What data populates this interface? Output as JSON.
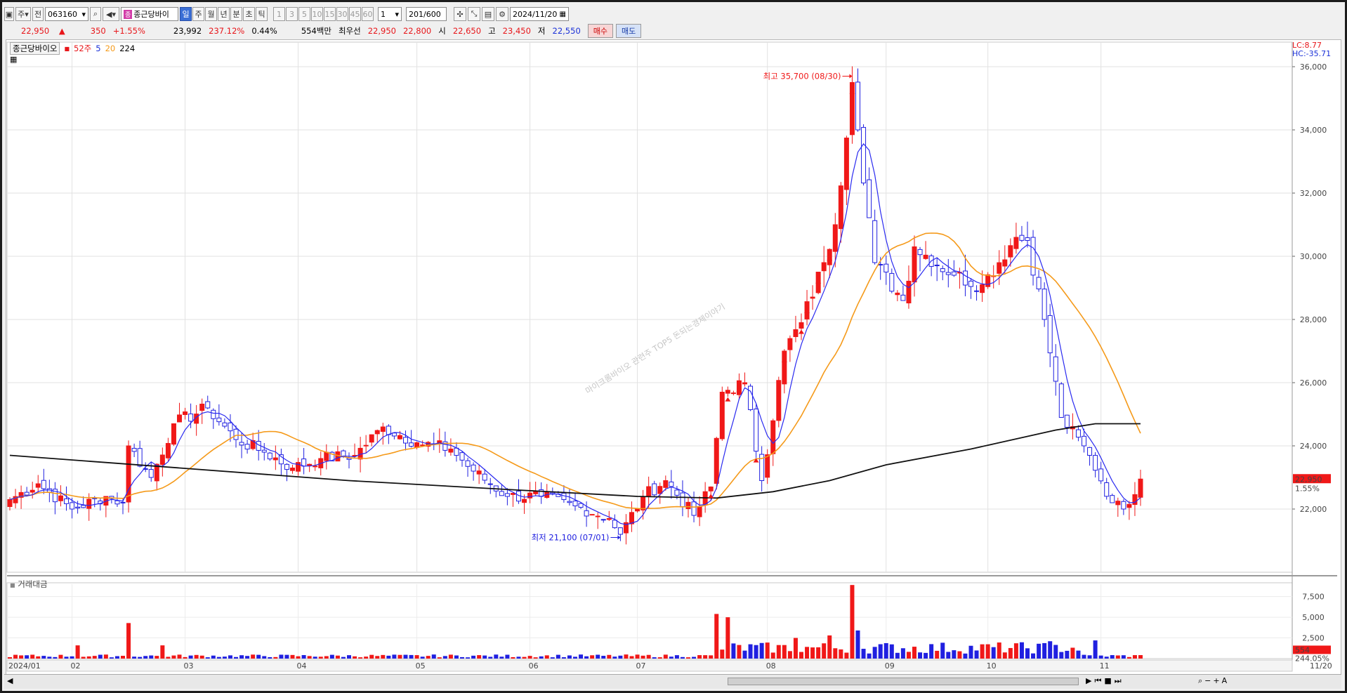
{
  "toolbar": {
    "market_select": "주",
    "market_type": "전",
    "code": "063160",
    "stock_name": "종근당바이",
    "periods": [
      "일",
      "주",
      "월",
      "년",
      "분",
      "초",
      "틱"
    ],
    "selected_period": "일",
    "intervals": [
      "1",
      "3",
      "5",
      "10",
      "15",
      "30",
      "45",
      "60"
    ],
    "interval_select": "1",
    "count_current": "201",
    "count_total": "/600",
    "date": "2024/11/20"
  },
  "quote": {
    "price": "22,950",
    "arrow": "▲",
    "change": "350",
    "change_pct": "+1.55%",
    "volume": "23,992",
    "vol_ratio": "237.12%",
    "turnover": "0.44%",
    "amount": "554백만",
    "best_label": "최우선",
    "best_ask": "22,950",
    "best_bid": "22,800",
    "open_label": "시",
    "open": "22,650",
    "high_label": "고",
    "high": "23,450",
    "low_label": "저",
    "low": "22,550",
    "buy_label": "매수",
    "sell_label": "매도"
  },
  "legend": {
    "name": "종근당바이오",
    "w52": "52주",
    "ma5": "5",
    "ma20": "20",
    "ma224": "224"
  },
  "lc_text": {
    "lc": "LC:8.77",
    "hc": "HC:-35.71"
  },
  "price_tag": {
    "price": "22,950",
    "pct": "1.55%"
  },
  "vol_tag": {
    "value": "554",
    "pct": "244.05%"
  },
  "volume_panel_label": "거래대금",
  "watermark": "마이크롬바이오 관련주 TOP5 돈되는경제이야기",
  "colors": {
    "up": "#f01818",
    "down": "#2020e0",
    "ma5": "#2a2af0",
    "ma20": "#f59a1a",
    "ma224": "#111111"
  },
  "chart_data": {
    "type": "candlestick",
    "price_axis": {
      "ylim": [
        20000,
        36600
      ],
      "ticks": [
        "22,000",
        "24,000",
        "26,000",
        "28,000",
        "30,000",
        "32,000",
        "34,000",
        "36,000"
      ],
      "tick_values": [
        22000,
        24000,
        26000,
        28000,
        30000,
        32000,
        34000,
        36000
      ]
    },
    "volume_axis": {
      "ylim": [
        0,
        9000
      ],
      "ticks": [
        "2,500",
        "5,000",
        "7,500"
      ],
      "tick_values": [
        2500,
        5000,
        7500
      ]
    },
    "x_labels": [
      {
        "i": 0,
        "label": "2024/01"
      },
      {
        "i": 11,
        "label": "02"
      },
      {
        "i": 31,
        "label": "03"
      },
      {
        "i": 51,
        "label": "04"
      },
      {
        "i": 72,
        "label": "05"
      },
      {
        "i": 92,
        "label": "06"
      },
      {
        "i": 111,
        "label": "07"
      },
      {
        "i": 134,
        "label": "08"
      },
      {
        "i": 155,
        "label": "09"
      },
      {
        "i": 173,
        "label": "10"
      },
      {
        "i": 193,
        "label": "11"
      },
      {
        "i": 213,
        "label": "11/20"
      }
    ],
    "annotations": {
      "high": {
        "text": "최고 35,700 (08/30)",
        "i": 149,
        "value": 35700
      },
      "low": {
        "text": "최저 21,100 (07/01)",
        "i": 108,
        "value": 21100
      }
    },
    "ohlc_anchors": [
      [
        0,
        22300
      ],
      [
        5,
        22800
      ],
      [
        11,
        22000
      ],
      [
        17,
        22400
      ],
      [
        20,
        22200
      ],
      [
        21,
        24000
      ],
      [
        25,
        23000
      ],
      [
        29,
        24700
      ],
      [
        35,
        25200
      ],
      [
        40,
        24200
      ],
      [
        45,
        23800
      ],
      [
        50,
        23300
      ],
      [
        55,
        23600
      ],
      [
        61,
        23700
      ],
      [
        66,
        24600
      ],
      [
        72,
        24100
      ],
      [
        78,
        23900
      ],
      [
        82,
        23200
      ],
      [
        88,
        22400
      ],
      [
        94,
        22400
      ],
      [
        100,
        22100
      ],
      [
        106,
        21700
      ],
      [
        108,
        21200
      ],
      [
        112,
        22400
      ],
      [
        116,
        22900
      ],
      [
        121,
        21800
      ],
      [
        124,
        22700
      ],
      [
        126,
        25700
      ],
      [
        130,
        26000
      ],
      [
        133,
        22900
      ],
      [
        137,
        27000
      ],
      [
        140,
        27900
      ],
      [
        144,
        29800
      ],
      [
        146,
        31000
      ],
      [
        149,
        35500
      ],
      [
        150,
        34000
      ],
      [
        153,
        29800
      ],
      [
        158,
        28600
      ],
      [
        160,
        30300
      ],
      [
        167,
        29400
      ],
      [
        172,
        29100
      ],
      [
        178,
        30600
      ],
      [
        180,
        30500
      ],
      [
        183,
        28000
      ],
      [
        186,
        24900
      ],
      [
        191,
        23700
      ],
      [
        195,
        22200
      ],
      [
        197,
        22000
      ],
      [
        200,
        22950
      ]
    ],
    "volume_spikes": [
      [
        12,
        1600
      ],
      [
        21,
        4300
      ],
      [
        27,
        1600
      ],
      [
        125,
        5400
      ],
      [
        127,
        5000
      ],
      [
        139,
        2500
      ],
      [
        145,
        2800
      ],
      [
        149,
        8900
      ],
      [
        150,
        3400
      ],
      [
        184,
        2100
      ],
      [
        192,
        2200
      ]
    ],
    "ma224": [
      [
        0,
        23700
      ],
      [
        30,
        23300
      ],
      [
        60,
        22900
      ],
      [
        90,
        22600
      ],
      [
        111,
        22400
      ],
      [
        125,
        22350
      ],
      [
        135,
        22550
      ],
      [
        145,
        22900
      ],
      [
        155,
        23400
      ],
      [
        170,
        23900
      ],
      [
        185,
        24500
      ],
      [
        192,
        24700
      ],
      [
        200,
        24700
      ]
    ]
  }
}
